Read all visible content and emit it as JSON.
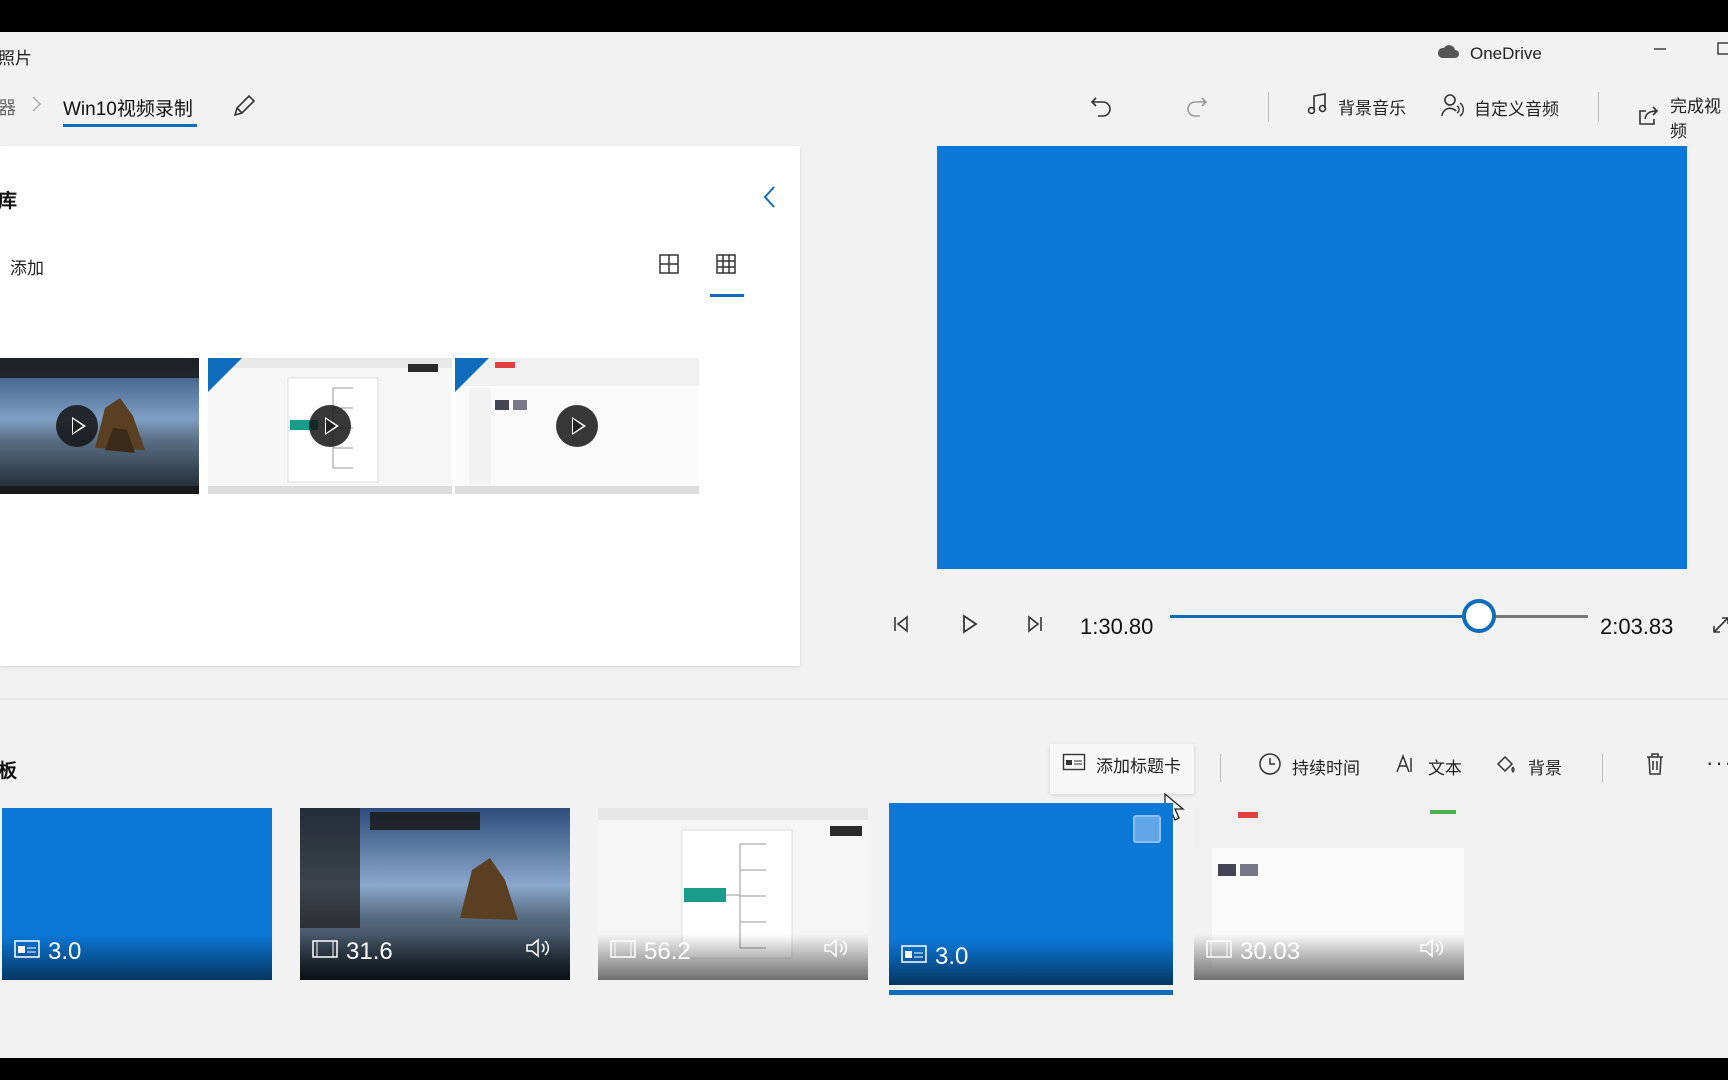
{
  "window": {
    "app_title": "照片",
    "onedrive_label": "OneDrive"
  },
  "toolbar": {
    "breadcrumb_prev": "器",
    "project_name": "Win10视频录制",
    "background_music": "背景音乐",
    "custom_audio": "自定义音频",
    "finish_video": "完成视频"
  },
  "library": {
    "title": "库",
    "add_label": "添加",
    "thumbnails": [
      {
        "kind": "landscape"
      },
      {
        "kind": "mindmap"
      },
      {
        "kind": "explorer"
      }
    ]
  },
  "player": {
    "current_time": "1:30.80",
    "total_time": "2:03.83",
    "progress_fraction": 0.74
  },
  "storyboard": {
    "title": "板",
    "add_title_card": "添加标题卡",
    "duration": "持续时间",
    "text": "文本",
    "background": "背景",
    "clips": [
      {
        "duration": "3.0",
        "kind": "title",
        "audio": false,
        "selected": false
      },
      {
        "duration": "31.6",
        "kind": "landscape",
        "audio": true,
        "selected": false
      },
      {
        "duration": "56.2",
        "kind": "mindmap",
        "audio": true,
        "selected": false
      },
      {
        "duration": "3.0",
        "kind": "title",
        "audio": false,
        "selected": true
      },
      {
        "duration": "30.03",
        "kind": "explorer",
        "audio": true,
        "selected": false
      }
    ]
  },
  "colors": {
    "accent": "#0f6cbd",
    "title_card_blue": "#0b78d7"
  }
}
